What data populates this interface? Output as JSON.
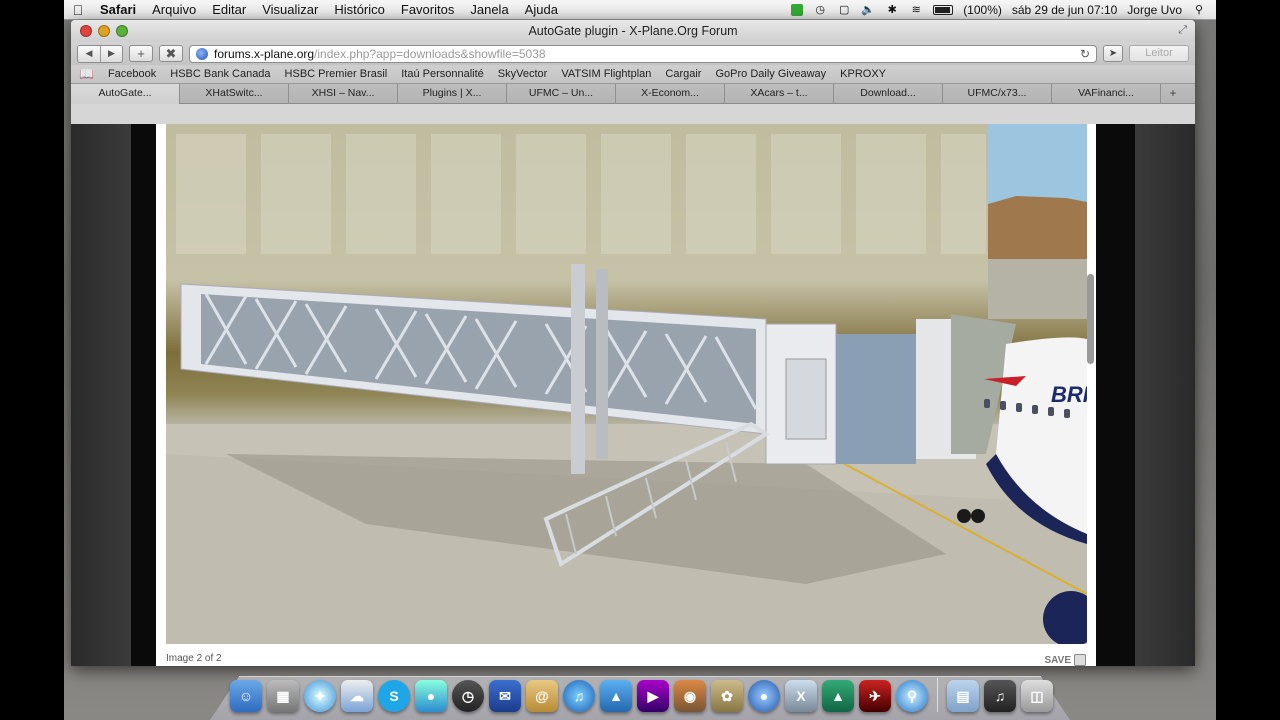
{
  "menubar": {
    "app": "Safari",
    "items": [
      "Arquivo",
      "Editar",
      "Visualizar",
      "Histórico",
      "Favoritos",
      "Janela",
      "Ajuda"
    ],
    "battery": "(100%)",
    "datetime": "sáb 29 de jun  07:10",
    "user": "Jorge Uvo"
  },
  "window": {
    "title": "AutoGate plugin - X-Plane.Org Forum",
    "url_host": "forums.x-plane.org",
    "url_path": "/index.php?app=downloads&showfile=5038",
    "reader_label": "Leitor"
  },
  "bookmarks": [
    "Facebook",
    "HSBC Bank Canada",
    "HSBC Premier Brasil",
    "Itaú Personnalité",
    "SkyVector",
    "VATSIM Flightplan",
    "Cargair",
    "GoPro Daily Giveaway",
    "KPROXY"
  ],
  "tabs": [
    "AutoGate...",
    "XHatSwitc...",
    "XHSI – Nav...",
    "Plugins | X...",
    "UFMC – Un...",
    "X-Econom...",
    "XAcars – t...",
    "Download...",
    "UFMC/x73...",
    "VAFinanci..."
  ],
  "lightbox": {
    "caption": "Image 2 of 2",
    "save_label": "SAVE",
    "aircraft_text": "BRI"
  },
  "dock": {
    "apps": [
      "finder",
      "calculator",
      "safari",
      "cloud",
      "skype",
      "people",
      "time-machine",
      "mail",
      "contacts",
      "itunes",
      "app",
      "imovie",
      "photos",
      "gimp",
      "google-earth",
      "x11",
      "x-plane",
      "xhsi",
      "browser",
      "folder",
      "music",
      "trash"
    ]
  }
}
